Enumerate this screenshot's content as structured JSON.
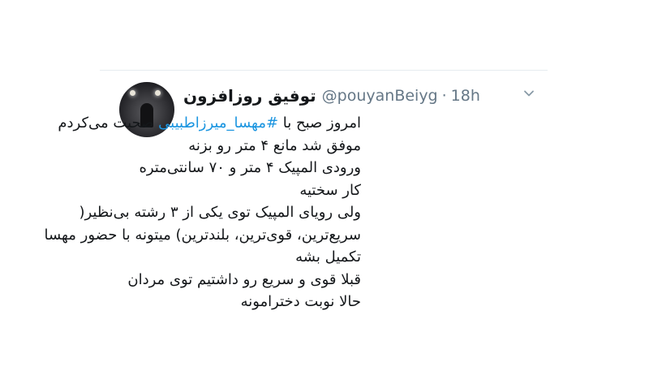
{
  "tweet": {
    "display_name": "توفیق روزافزون",
    "handle": "@pouyanBeiyg",
    "separator": "·",
    "time": "18h",
    "avatar_icon": "profile-photo",
    "menu_icon": "chevron-down-icon",
    "hashtag_color": "#1b95e0",
    "lines": {
      "l1_before": "امروز صبح با ",
      "l1_hashtag": "#مهسا_میرزاطبیبی",
      "l1_after": " صحبت می‌کردم",
      "l2": "موفق شد مانع ۴ متر رو بزنه",
      "l3": "ورودی المپیک ۴ متر و ۷۰ سانتی‌متره",
      "l4": "کار سختیه",
      "l5": "ولی رویای المپیک توی یکی از ۳ رشته بی‌نظیر(",
      "l6": "سریع‌ترین، قوی‌ترین، بلندترین) میتونه با حضور مهسا",
      "l7": "تکمیل بشه",
      "l8": "قبلا قوی و سریع رو داشتیم توی مردان",
      "l9": "حالا نوبت دخترامونه"
    }
  }
}
